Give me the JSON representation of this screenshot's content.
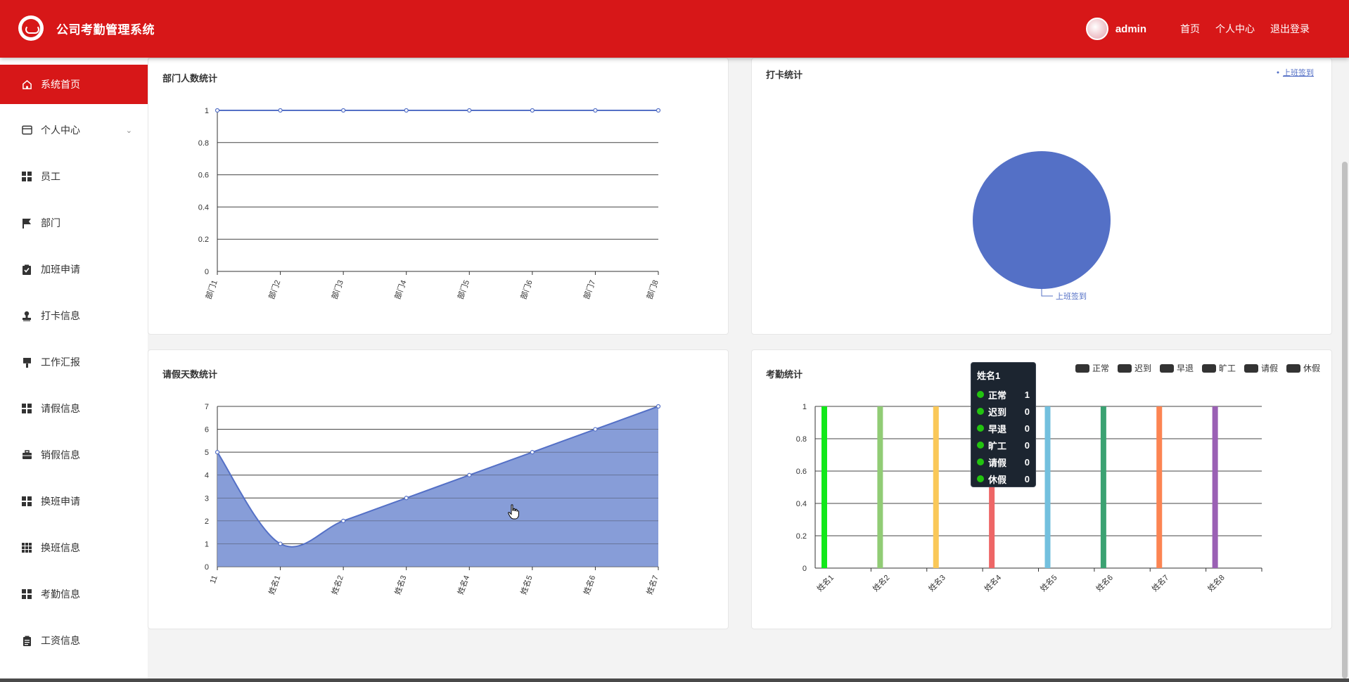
{
  "header": {
    "title": "公司考勤管理系统",
    "user": "admin",
    "nav": [
      "首页",
      "个人中心",
      "退出登录"
    ]
  },
  "sidebar": {
    "items": [
      {
        "label": "系统首页",
        "icon": "home-icon",
        "active": true
      },
      {
        "label": "个人中心",
        "icon": "wallet-icon",
        "expandable": true
      },
      {
        "label": "员工",
        "icon": "grid-icon"
      },
      {
        "label": "部门",
        "icon": "flag-icon"
      },
      {
        "label": "加班申请",
        "icon": "clipboard-check-icon"
      },
      {
        "label": "打卡信息",
        "icon": "stamp-icon"
      },
      {
        "label": "工作汇报",
        "icon": "brush-icon"
      },
      {
        "label": "请假信息",
        "icon": "grid-icon"
      },
      {
        "label": "销假信息",
        "icon": "briefcase-icon"
      },
      {
        "label": "换班申请",
        "icon": "grid-icon"
      },
      {
        "label": "换班信息",
        "icon": "grid-dense-icon"
      },
      {
        "label": "考勤信息",
        "icon": "grid-icon"
      },
      {
        "label": "工资信息",
        "icon": "clipboard-icon"
      }
    ]
  },
  "panels": {
    "dept": {
      "title": "部门人数统计"
    },
    "checkin": {
      "title": "打卡统计"
    },
    "leave": {
      "title": "请假天数统计"
    },
    "attendance": {
      "title": "考勤统计"
    }
  },
  "tooltip": {
    "title": "姓名1",
    "rows": [
      {
        "label": "正常",
        "value": "1"
      },
      {
        "label": "迟到",
        "value": "0"
      },
      {
        "label": "早退",
        "value": "0"
      },
      {
        "label": "旷工",
        "value": "0"
      },
      {
        "label": "请假",
        "value": "0"
      },
      {
        "label": "休假",
        "value": "0"
      }
    ]
  },
  "colors": {
    "brand": "#d71718",
    "series_blue": "#5470c6",
    "area_fill": "#8198d6"
  },
  "chart_data": [
    {
      "type": "line",
      "title": "部门人数统计",
      "categories": [
        "部门1",
        "部门2",
        "部门3",
        "部门4",
        "部门5",
        "部门6",
        "部门7",
        "部门8"
      ],
      "values": [
        1,
        1,
        1,
        1,
        1,
        1,
        1,
        1
      ],
      "ylim": [
        0,
        1
      ],
      "yticks": [
        0,
        0.2,
        0.4,
        0.6,
        0.8,
        1
      ],
      "grid": true
    },
    {
      "type": "pie",
      "title": "打卡统计",
      "slices": [
        {
          "name": "上班签到",
          "value": 1
        }
      ],
      "legend": "top-right"
    },
    {
      "type": "area",
      "title": "请假天数统计",
      "categories": [
        "11",
        "姓名1",
        "姓名2",
        "姓名3",
        "姓名4",
        "姓名5",
        "姓名6",
        "姓名7"
      ],
      "values": [
        5,
        1,
        2,
        3,
        4,
        5,
        6,
        7
      ],
      "ylim": [
        0,
        7
      ],
      "yticks": [
        0,
        1,
        2,
        3,
        4,
        5,
        6,
        7
      ],
      "grid": true
    },
    {
      "type": "bar",
      "title": "考勤统计",
      "categories": [
        "姓名1",
        "姓名2",
        "姓名3",
        "姓名4",
        "姓名5",
        "姓名6",
        "姓名7",
        "姓名8"
      ],
      "values": [
        1,
        1,
        1,
        1,
        1,
        1,
        1,
        1
      ],
      "bar_colors": [
        "#12e81a",
        "#91cc75",
        "#fac858",
        "#ee6666",
        "#73c0de",
        "#3ba272",
        "#fc8452",
        "#9a60b4"
      ],
      "legend": [
        "正常",
        "迟到",
        "早退",
        "旷工",
        "请假",
        "休假"
      ],
      "legend_placement": "top-right",
      "ylim": [
        0,
        1
      ],
      "yticks": [
        0,
        0.2,
        0.4,
        0.6,
        0.8,
        1
      ],
      "grid": true
    }
  ]
}
